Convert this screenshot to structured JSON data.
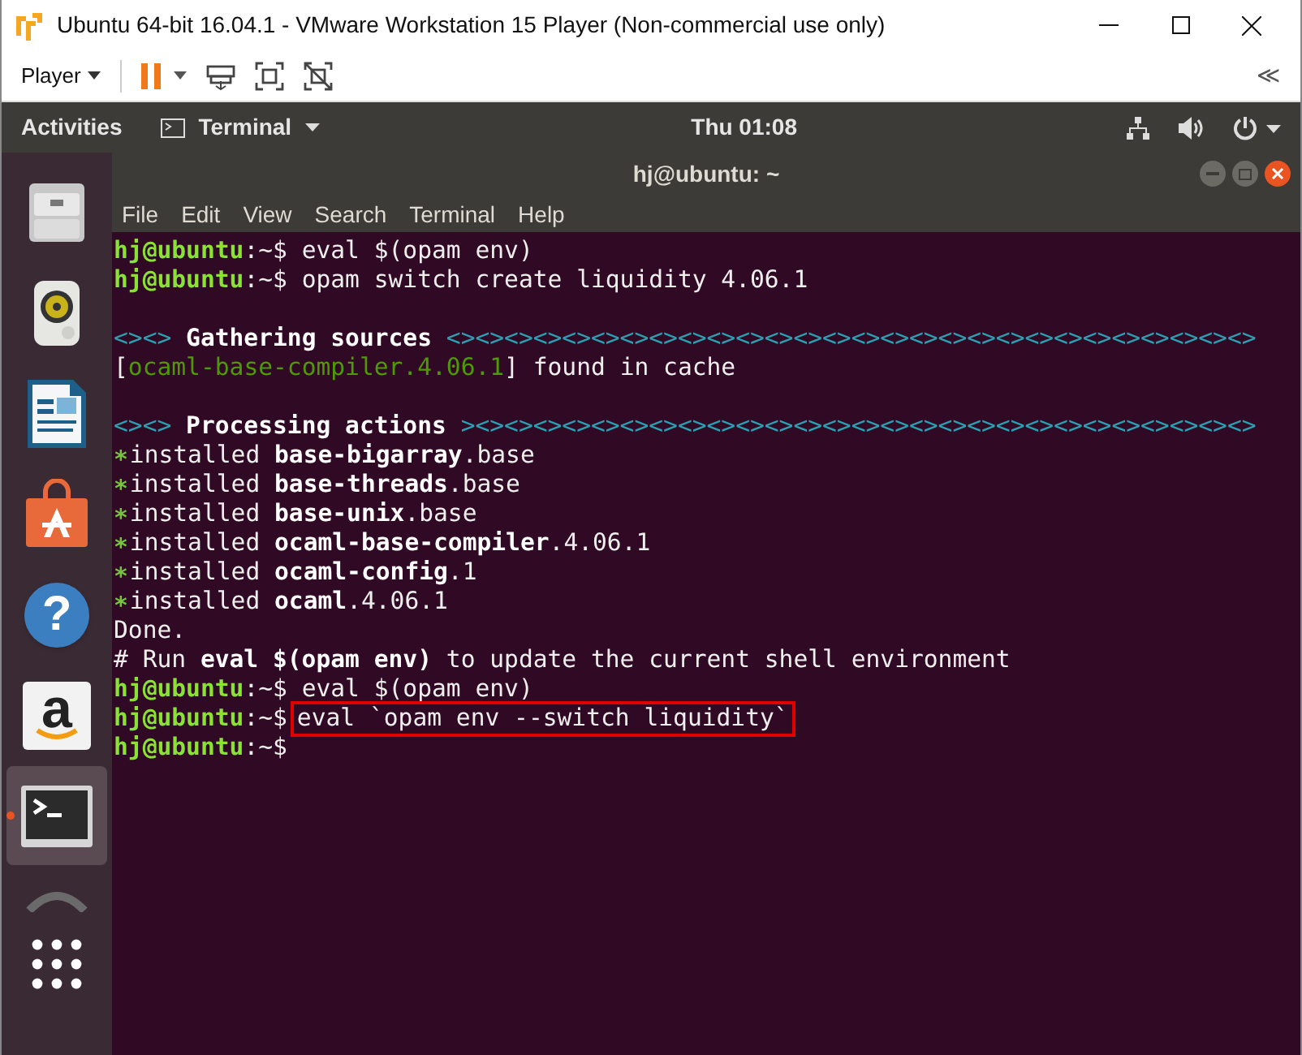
{
  "vm_window": {
    "title": "Ubuntu 64-bit 16.04.1 - VMware Workstation 15 Player (Non-commercial use only)",
    "player_menu": "Player",
    "expand_glyph": "≪"
  },
  "top_bar": {
    "activities": "Activities",
    "app_menu": "Terminal",
    "clock": "Thu 01:08"
  },
  "dock": [
    {
      "kind": "files",
      "selected": false,
      "running": false
    },
    {
      "kind": "speaker",
      "selected": false,
      "running": false
    },
    {
      "kind": "document",
      "selected": false,
      "running": false
    },
    {
      "kind": "bag",
      "selected": false,
      "running": false
    },
    {
      "kind": "help",
      "glyph": "?",
      "selected": false,
      "running": false
    },
    {
      "kind": "amazon",
      "glyph": "a",
      "selected": false,
      "running": false
    },
    {
      "kind": "terminal",
      "selected": true,
      "running": true
    },
    {
      "kind": "arrow",
      "selected": false,
      "running": false
    },
    {
      "kind": "grid",
      "selected": false,
      "running": false
    }
  ],
  "terminal": {
    "title": "hj@ubuntu: ~",
    "menu": [
      "File",
      "Edit",
      "View",
      "Search",
      "Terminal",
      "Help"
    ],
    "lines": [
      {
        "kind": "text",
        "segments": [
          {
            "kind": "prompt",
            "text": "hj@ubuntu"
          },
          {
            "kind": "plain",
            "text": ":~$ eval $(opam env)"
          }
        ]
      },
      {
        "kind": "text",
        "segments": [
          {
            "kind": "prompt",
            "text": "hj@ubuntu"
          },
          {
            "kind": "plain",
            "text": ":~$ opam switch create liquidity 4.06.1"
          }
        ]
      },
      {
        "kind": "blank"
      },
      {
        "kind": "text",
        "segments": [
          {
            "kind": "cyan",
            "text": "<><>"
          },
          {
            "kind": "bold",
            "text": " Gathering sources "
          },
          {
            "kind": "cyan",
            "text": "<><><><><><><><><><><><><><><><><><><><><><><><><><><><>"
          }
        ]
      },
      {
        "kind": "text",
        "segments": [
          {
            "kind": "plain",
            "text": "["
          },
          {
            "kind": "green",
            "text": "ocaml-base-compiler.4.06.1"
          },
          {
            "kind": "plain",
            "text": "] found in cache"
          }
        ]
      },
      {
        "kind": "blank"
      },
      {
        "kind": "text",
        "segments": [
          {
            "kind": "cyan",
            "text": "<><>"
          },
          {
            "kind": "bold",
            "text": " Processing actions "
          },
          {
            "kind": "cyan",
            "text": "><><><><><><><><><><><><><><><><><><><><><><><><><><><>"
          }
        ]
      },
      {
        "kind": "text",
        "segments": [
          {
            "kind": "star",
            "text": "∗"
          },
          {
            "kind": "plain",
            "text": "installed "
          },
          {
            "kind": "bold",
            "text": "base-bigarray"
          },
          {
            "kind": "plain",
            "text": ".base"
          }
        ]
      },
      {
        "kind": "text",
        "segments": [
          {
            "kind": "star",
            "text": "∗"
          },
          {
            "kind": "plain",
            "text": "installed "
          },
          {
            "kind": "bold",
            "text": "base-threads"
          },
          {
            "kind": "plain",
            "text": ".base"
          }
        ]
      },
      {
        "kind": "text",
        "segments": [
          {
            "kind": "star",
            "text": "∗"
          },
          {
            "kind": "plain",
            "text": "installed "
          },
          {
            "kind": "bold",
            "text": "base-unix"
          },
          {
            "kind": "plain",
            "text": ".base"
          }
        ]
      },
      {
        "kind": "text",
        "segments": [
          {
            "kind": "star",
            "text": "∗"
          },
          {
            "kind": "plain",
            "text": "installed "
          },
          {
            "kind": "bold",
            "text": "ocaml-base-compiler"
          },
          {
            "kind": "plain",
            "text": ".4.06.1"
          }
        ]
      },
      {
        "kind": "text",
        "segments": [
          {
            "kind": "star",
            "text": "∗"
          },
          {
            "kind": "plain",
            "text": "installed "
          },
          {
            "kind": "bold",
            "text": "ocaml-config"
          },
          {
            "kind": "plain",
            "text": ".1"
          }
        ]
      },
      {
        "kind": "text",
        "segments": [
          {
            "kind": "star",
            "text": "∗"
          },
          {
            "kind": "plain",
            "text": "installed "
          },
          {
            "kind": "bold",
            "text": "ocaml"
          },
          {
            "kind": "plain",
            "text": ".4.06.1"
          }
        ]
      },
      {
        "kind": "text",
        "segments": [
          {
            "kind": "plain",
            "text": "Done."
          }
        ]
      },
      {
        "kind": "text",
        "segments": [
          {
            "kind": "plain",
            "text": "# Run "
          },
          {
            "kind": "bold",
            "text": "eval $(opam env)"
          },
          {
            "kind": "plain",
            "text": " to update the current shell environment"
          }
        ]
      },
      {
        "kind": "text",
        "segments": [
          {
            "kind": "prompt",
            "text": "hj@ubuntu"
          },
          {
            "kind": "plain",
            "text": ":~$ eval $(opam env)"
          }
        ]
      },
      {
        "kind": "text",
        "segments": [
          {
            "kind": "prompt",
            "text": "hj@ubuntu"
          },
          {
            "kind": "plain",
            "text": ":~$"
          },
          {
            "kind": "boxed",
            "text": "eval `opam env --switch liquidity`"
          }
        ]
      },
      {
        "kind": "text",
        "segments": [
          {
            "kind": "prompt",
            "text": "hj@ubuntu"
          },
          {
            "kind": "plain",
            "text": ":~$"
          }
        ]
      }
    ]
  }
}
